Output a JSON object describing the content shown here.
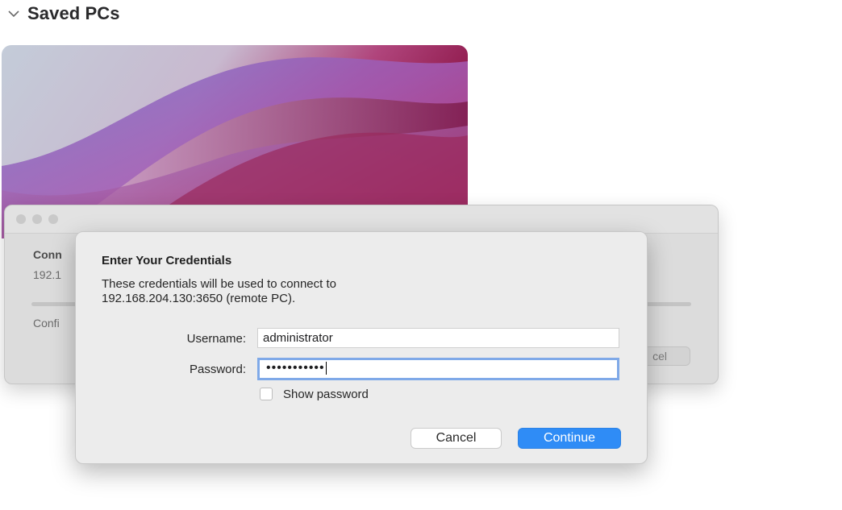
{
  "section": {
    "title": "Saved PCs",
    "chevron_icon": "chevron-down-icon"
  },
  "background_window": {
    "title_partial": "Conn",
    "address_partial": "192.1",
    "status_partial": "Confi",
    "button_partial": "cel",
    "progress": 0
  },
  "dialog": {
    "title": "Enter Your Credentials",
    "message_line1": "These credentials will be used to connect to",
    "message_line2": "192.168.204.130:3650 (remote PC).",
    "username_label": "Username:",
    "username_value": "administrator",
    "password_label": "Password:",
    "password_masked": "•••••••••••",
    "show_password_label": "Show password",
    "show_password_checked": false,
    "cancel_label": "Cancel",
    "continue_label": "Continue"
  },
  "colors": {
    "accent": "#2f8cf6",
    "focus_ring": "#7fa9e8",
    "dialog_bg": "#ececec"
  }
}
